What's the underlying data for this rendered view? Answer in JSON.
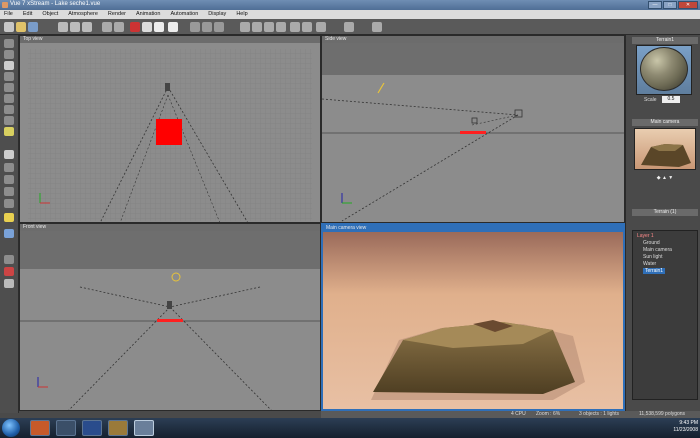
{
  "window": {
    "title": "Vue 7 xStream - Lake seche1.vue",
    "minimize": "—",
    "maximize": "□",
    "close": "✕"
  },
  "menu": [
    "File",
    "Edit",
    "Object",
    "Atmosphere",
    "Render",
    "Animation",
    "Automation",
    "Display",
    "Help"
  ],
  "viewports": {
    "top": "Top view",
    "side": "Side view",
    "front": "Front view",
    "camera": "Main camera view"
  },
  "right_panel": {
    "material_title": "Terrain1",
    "scale_label": "Scale",
    "scale_value": "0.5",
    "camera_title": "Main camera",
    "outline_title": "Terrain (1)",
    "outline_items": [
      {
        "label": "Layer 1",
        "style": "layer"
      },
      {
        "label": "Ground",
        "style": "normal"
      },
      {
        "label": "Main camera",
        "style": "normal"
      },
      {
        "label": "Sun light",
        "style": "normal"
      },
      {
        "label": "Water",
        "style": "normal"
      },
      {
        "label": "Terrain1",
        "style": "selected"
      }
    ]
  },
  "status": {
    "cpu": "4 CPU",
    "zoom": "Zoom : 6%",
    "objects": "3 objects : 1 lights",
    "polygons": "11,538,599 polygons"
  },
  "taskbar": {
    "time": "9:43 PM",
    "date": "11/23/2008"
  },
  "colors": {
    "selection_blue": "#2f6fb8",
    "terrain_red": "#ff0000"
  }
}
